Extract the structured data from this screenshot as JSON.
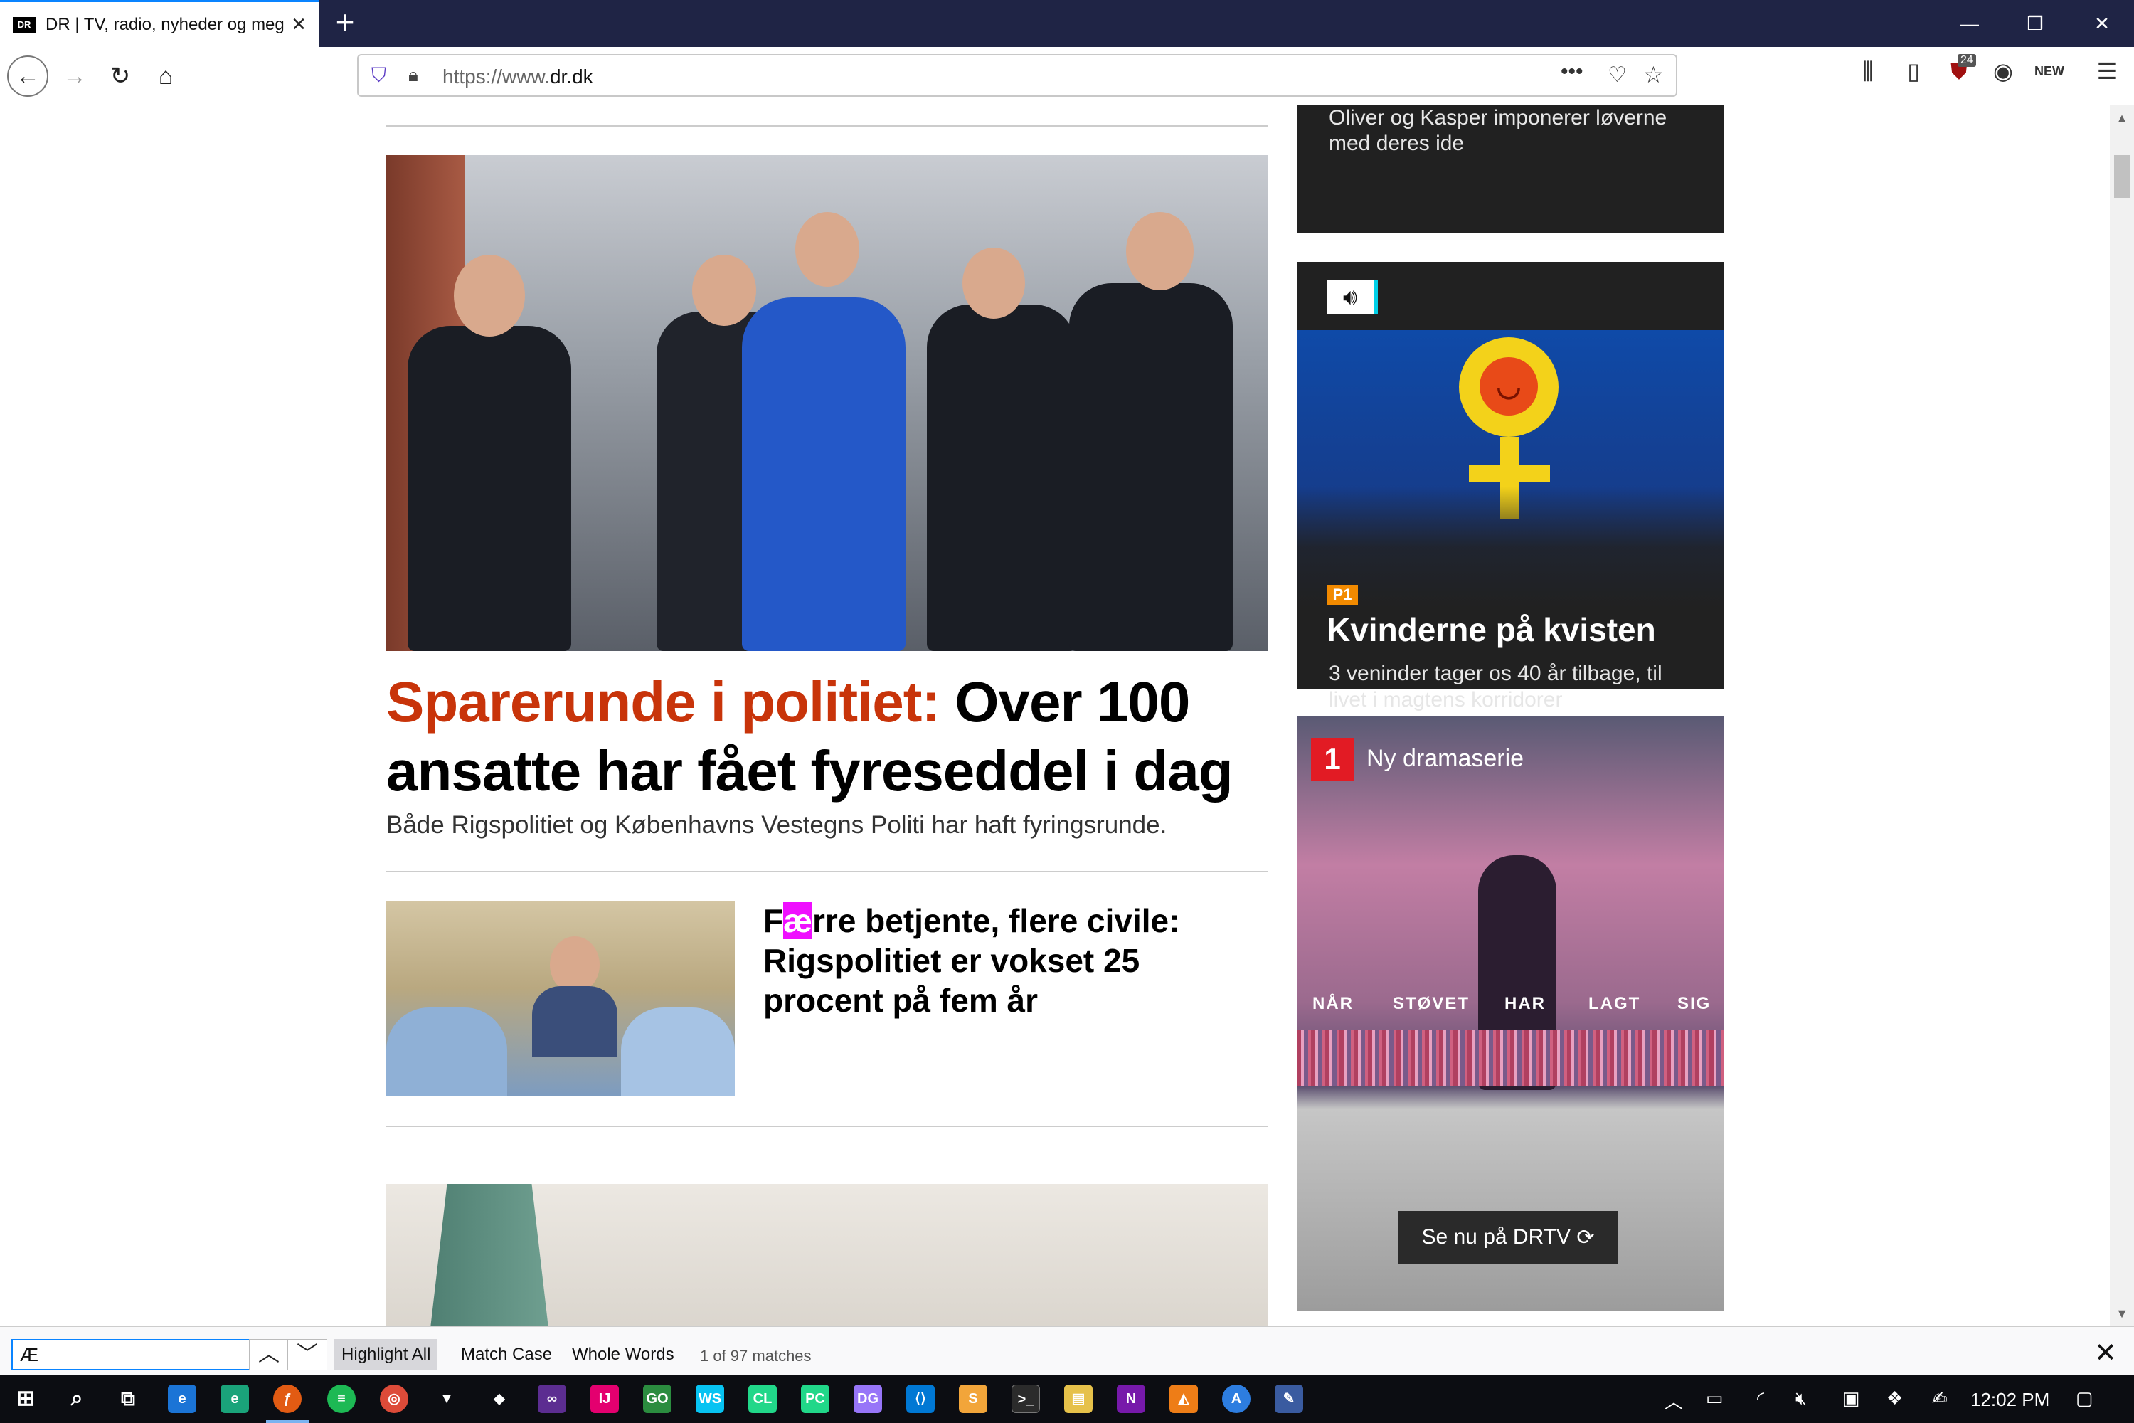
{
  "browser": {
    "tab_title": "DR | TV, radio, nyheder og meg",
    "tab_favicon": "DR",
    "url_prefix": "https://www.",
    "url_domain": "dr.dk",
    "url_actions": "•••",
    "notification_count": "24"
  },
  "sidebar": {
    "card1_text": "Oliver og Kasper imponerer løverne med deres ide",
    "p1_icon": "speaker-icon",
    "p1_badge": "P1",
    "p1_title": "Kvinderne på kvisten",
    "p1_desc": "3 veninder tager os 40 år tilbage, til livet i magtens korridorer",
    "drama_logo": "1",
    "drama_label": "Ny dramaserie",
    "drama_words": [
      "NÅR",
      "STØVET",
      "HAR",
      "LAGT",
      "SIG"
    ],
    "drama_cta": "Se nu på DRTV"
  },
  "main": {
    "kicker": "Sparerunde i politiet:",
    "headline": " Over 100 ansatte har fået fyreseddel i dag",
    "subline": "Både Rigspolitiet og Københavns Vestegns Politi har haft fyringsrunde.",
    "thumb_pre": "F",
    "thumb_match": "æ",
    "thumb_post": "rre betjente, flere civile: Rigspolitiet er vokset 25 procent på fem år"
  },
  "findbar": {
    "query": "Æ",
    "highlight_all": "Highlight All",
    "match_case": "Match Case",
    "whole_words": "Whole Words",
    "status": "1 of 97 matches"
  },
  "taskbar": {
    "time": "12:02 PM"
  },
  "colors": {
    "kicker": "#c8340a",
    "highlight": "#ef0fff",
    "titlebar": "#1f2445"
  }
}
